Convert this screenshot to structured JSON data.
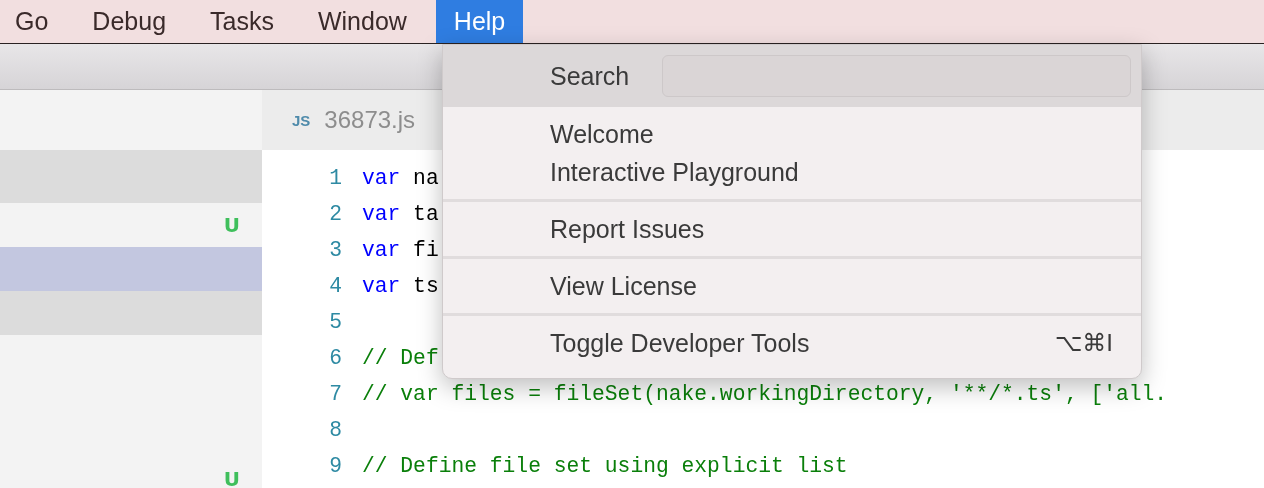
{
  "menu_bar": [
    {
      "label": "Go",
      "selected": false
    },
    {
      "label": "Debug",
      "selected": false
    },
    {
      "label": "Tasks",
      "selected": false
    },
    {
      "label": "Window",
      "selected": false
    },
    {
      "label": "Help",
      "selected": true
    }
  ],
  "sidebar": {
    "rows": [
      {
        "highlighted": true,
        "selected": false
      },
      {
        "highlighted": false,
        "selected": false,
        "badge": "U"
      },
      {
        "highlighted": false,
        "selected": true
      },
      {
        "highlighted": true,
        "selected": false
      },
      {
        "highlighted": false,
        "selected": false,
        "badge": "U"
      }
    ]
  },
  "editor": {
    "tab": {
      "icon_label": "JS",
      "title": "36873.js"
    },
    "lines": [
      {
        "number": "1",
        "tokens": [
          {
            "kind": "keyword",
            "text": "var"
          },
          {
            "kind": "plain",
            "text": " na"
          }
        ]
      },
      {
        "number": "2",
        "tokens": [
          {
            "kind": "keyword",
            "text": "var"
          },
          {
            "kind": "plain",
            "text": " ta"
          }
        ]
      },
      {
        "number": "3",
        "tokens": [
          {
            "kind": "keyword",
            "text": "var"
          },
          {
            "kind": "plain",
            "text": " fi"
          }
        ]
      },
      {
        "number": "4",
        "tokens": [
          {
            "kind": "keyword",
            "text": "var"
          },
          {
            "kind": "plain",
            "text": " ts"
          }
        ]
      },
      {
        "number": "5"
      },
      {
        "number": "6",
        "tokens": [
          {
            "kind": "comment",
            "text": "// Def"
          }
        ]
      },
      {
        "number": "7",
        "tokens": [
          {
            "kind": "comment",
            "text": "// var files = fileSet(nake.workingDirectory, '**/*.ts', ['all."
          }
        ]
      },
      {
        "number": "8"
      },
      {
        "number": "9",
        "tokens": [
          {
            "kind": "comment",
            "text": "// Define file set using explicit list"
          }
        ]
      }
    ]
  },
  "help_menu": {
    "search": {
      "label": "Search"
    },
    "groups": [
      [
        {
          "label": "Welcome"
        },
        {
          "label": "Interactive Playground"
        }
      ],
      [
        {
          "label": "Report Issues"
        }
      ],
      [
        {
          "label": "View License"
        }
      ],
      [
        {
          "label": "Toggle Developer Tools",
          "shortcut": "⌥⌘I"
        }
      ]
    ]
  }
}
